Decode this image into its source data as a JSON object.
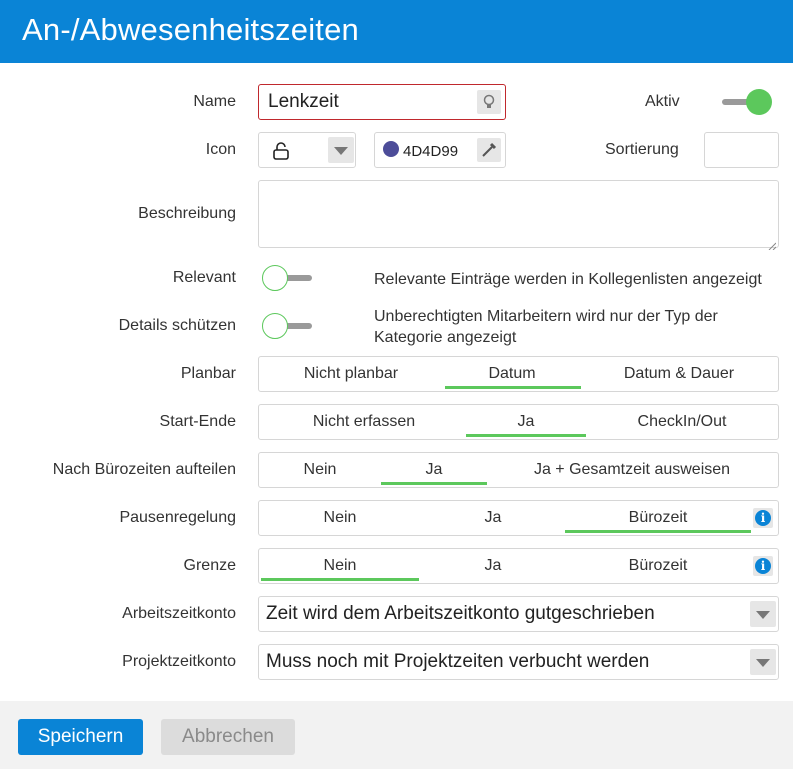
{
  "title": "An-/Abwesenheitszeiten",
  "fields": {
    "name_label": "Name",
    "name_value": "Lenkzeit",
    "active_label": "Aktiv",
    "icon_label": "Icon",
    "color_value": "4D4D99",
    "color_swatch": "#4D4D99",
    "sort_label": "Sortierung",
    "sort_value": "",
    "desc_label": "Beschreibung",
    "desc_value": "",
    "relevant_label": "Relevant",
    "relevant_text": "Relevante Einträge werden in Kollegenlisten angezeigt",
    "details_label": "Details schützen",
    "details_text_1": "Unberechtigten Mitarbeitern wird nur der Typ der",
    "details_text_2": "Kategorie angezeigt"
  },
  "toggles": {
    "active": true,
    "relevant": false,
    "details": false
  },
  "segments": [
    {
      "label": "Planbar",
      "options": [
        "Nicht planbar",
        "Datum",
        "Datum & Dauer"
      ],
      "selected": "Datum"
    },
    {
      "label": "Start-Ende",
      "options": [
        "Nicht erfassen",
        "Ja",
        "CheckIn/Out"
      ],
      "selected": "Ja"
    },
    {
      "label": "Nach Bürozeiten aufteilen",
      "options": [
        "Nein",
        "Ja",
        "Ja + Gesamtzeit ausweisen"
      ],
      "selected": "Ja"
    },
    {
      "label": "Pausenregelung",
      "options": [
        "Nein",
        "Ja",
        "Bürozeit"
      ],
      "selected": "Bürozeit"
    },
    {
      "label": "Grenze",
      "options": [
        "Nein",
        "Ja",
        "Bürozeit"
      ],
      "selected": "Nein"
    }
  ],
  "selects": {
    "arbeitszeit_label": "Arbeitszeitkonto",
    "arbeitszeit_value": "Zeit wird dem Arbeitszeitkonto gutgeschrieben",
    "projektzeit_label": "Projektzeitkonto",
    "projektzeit_value": "Muss noch mit Projektzeiten verbucht werden"
  },
  "buttons": {
    "save": "Speichern",
    "cancel": "Abbrechen"
  },
  "colors": {
    "accent": "#0a84d6",
    "toggle_on": "#5cc85c",
    "error_border": "#c0282d"
  },
  "icons": {
    "name_hint": "lightbulb-icon",
    "icon_value": "lock-icon",
    "color_picker": "eyedropper-icon",
    "info": "info-icon"
  }
}
